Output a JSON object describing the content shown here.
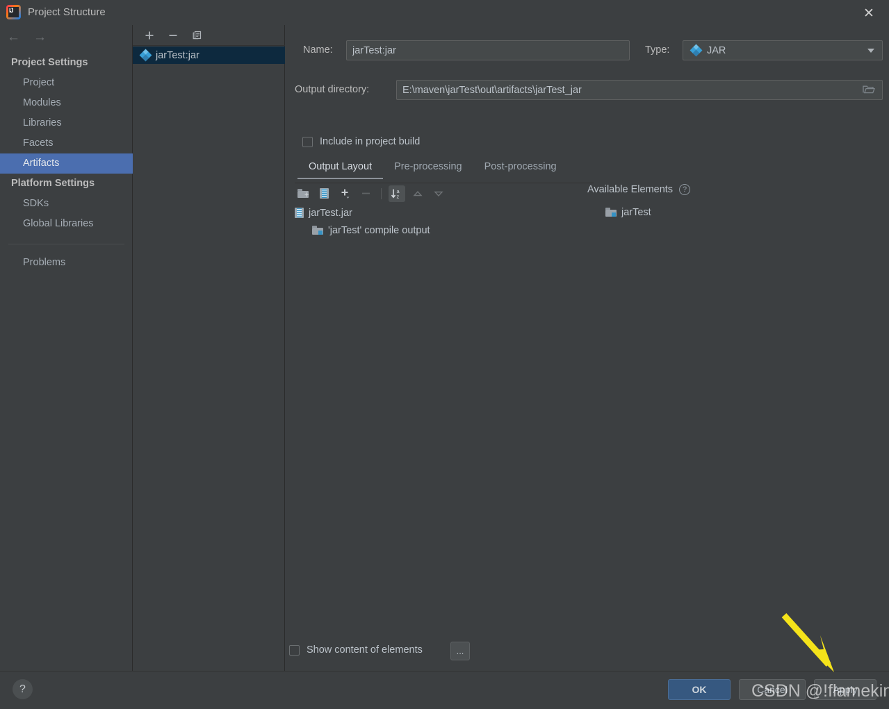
{
  "window": {
    "title": "Project Structure",
    "logo_icon": "intellij-idea-logo",
    "close_icon": "close-icon",
    "back_icon": "arrow-left-icon",
    "forward_icon": "arrow-right-icon"
  },
  "sidebar": {
    "groups": [
      {
        "label": "Project Settings",
        "items": [
          {
            "label": "Project",
            "selected": false
          },
          {
            "label": "Modules",
            "selected": false
          },
          {
            "label": "Libraries",
            "selected": false
          },
          {
            "label": "Facets",
            "selected": false
          },
          {
            "label": "Artifacts",
            "selected": true
          }
        ]
      },
      {
        "label": "Platform Settings",
        "items": [
          {
            "label": "SDKs",
            "selected": false
          },
          {
            "label": "Global Libraries",
            "selected": false
          }
        ]
      }
    ],
    "problems_label": "Problems"
  },
  "artifact_panel": {
    "toolbar": [
      {
        "name": "add-artifact-button",
        "glyph": "+"
      },
      {
        "name": "remove-artifact-button",
        "glyph": "−"
      },
      {
        "name": "copy-artifact-button",
        "glyph": "❐"
      }
    ],
    "items": [
      {
        "label": "jarTest:jar",
        "icon": "artifact-diamond-icon",
        "selected": true
      }
    ]
  },
  "form": {
    "name_label": "Name:",
    "name_value": "jarTest:jar",
    "name_placeholder": "",
    "type_label": "Type:",
    "type_value": "JAR",
    "type_icon": "artifact-diamond-icon",
    "type_chevron_icon": "chevron-down-icon",
    "output_dir_label": "Output directory:",
    "output_dir_value": "E:\\maven\\jarTest\\out\\artifacts\\jarTest_jar",
    "output_dir_placeholder": "",
    "browse_icon": "folder-open-icon",
    "include_in_build_label": "Include in project build",
    "include_in_build_checked": false
  },
  "tabs": [
    {
      "label": "Output Layout",
      "active": true
    },
    {
      "label": "Pre-processing",
      "active": false
    },
    {
      "label": "Post-processing",
      "active": false
    }
  ],
  "layout_toolbar": [
    {
      "name": "create-directory-button",
      "icon": "folder-add-icon",
      "state": "enabled"
    },
    {
      "name": "create-archive-button",
      "icon": "jar-archive-icon",
      "state": "enabled"
    },
    {
      "name": "add-element-button",
      "icon": "plus-dropdown-icon",
      "state": "enabled"
    },
    {
      "name": "remove-element-button",
      "icon": "minus-icon",
      "state": "disabled"
    },
    {
      "name": "sort-elements-button",
      "icon": "sort-alpha-icon",
      "state": "pressed"
    },
    {
      "name": "move-up-button",
      "icon": "triangle-up-icon",
      "state": "disabled"
    },
    {
      "name": "move-down-button",
      "icon": "triangle-down-icon",
      "state": "disabled"
    }
  ],
  "output_layout_tree": [
    {
      "label": "jarTest.jar",
      "icon": "jar-archive-icon",
      "level": 0
    },
    {
      "label": "'jarTest' compile output",
      "icon": "module-output-folder-icon",
      "level": 1
    }
  ],
  "available_elements": {
    "title": "Available Elements",
    "help_icon": "help-circle-icon",
    "items": [
      {
        "label": "jarTest",
        "icon": "module-output-folder-icon"
      }
    ]
  },
  "footer_options": {
    "show_content_label": "Show content of elements",
    "show_content_checked": false,
    "more_button_label": "..."
  },
  "dialog_buttons": {
    "help_label": "?",
    "ok_label": "OK",
    "cancel_label": "Cancel",
    "apply_label": "Apply"
  },
  "annotation": {
    "arrow_color": "#f5e31a",
    "watermark": "CSDN @!flameking"
  },
  "colors": {
    "background": "#3c3f41",
    "selection_blue": "#4b6eaf",
    "tree_selection": "#0d293e",
    "accent_blue": "#3592c4",
    "ok_button": "#365880",
    "text": "#bcc3ca"
  }
}
